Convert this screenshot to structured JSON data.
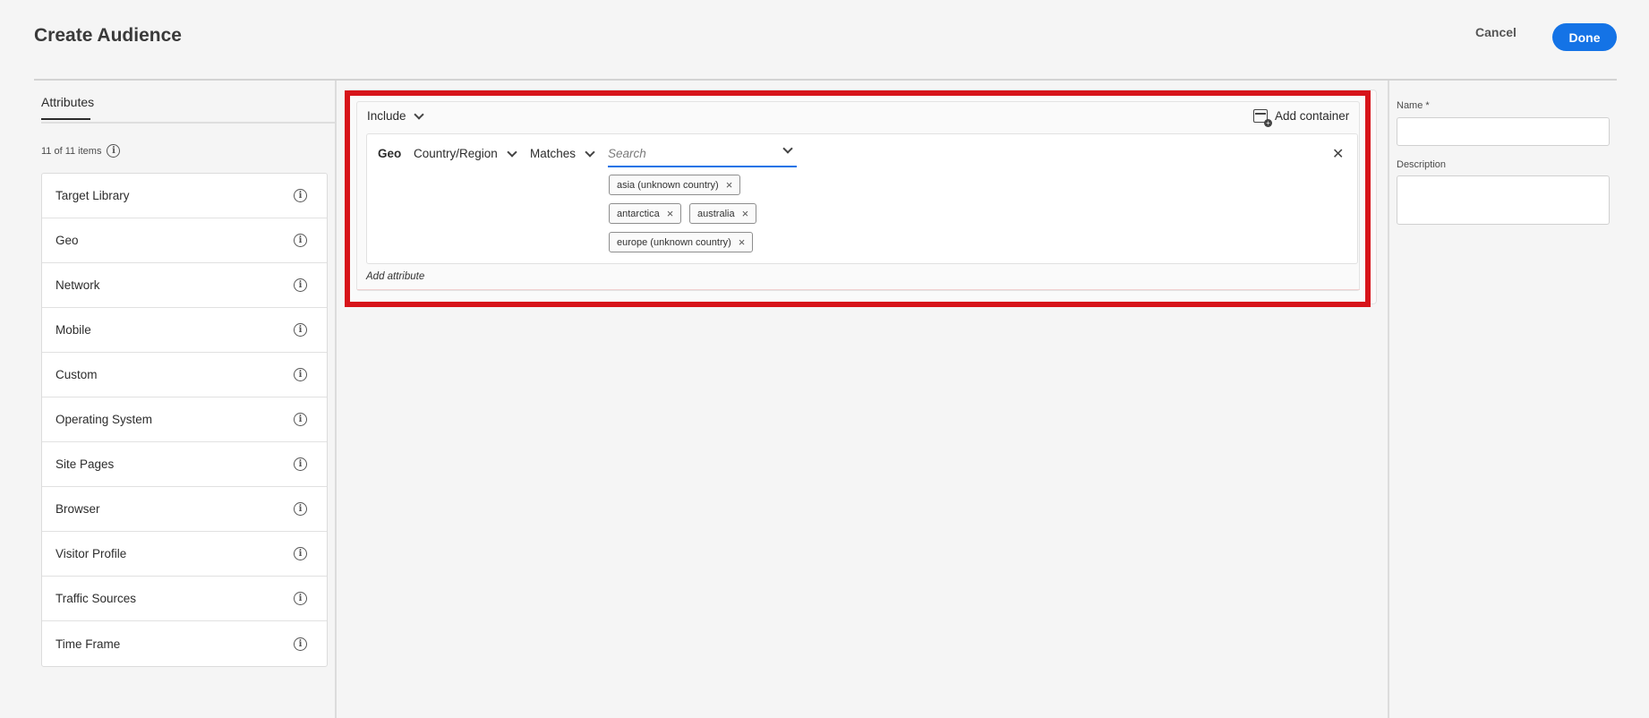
{
  "header": {
    "title": "Create Audience",
    "cancel_label": "Cancel",
    "done_label": "Done"
  },
  "sidebar": {
    "tab_label": "Attributes",
    "count_text": "11 of 11 items",
    "items": [
      {
        "label": "Target Library"
      },
      {
        "label": "Geo"
      },
      {
        "label": "Network"
      },
      {
        "label": "Mobile"
      },
      {
        "label": "Custom"
      },
      {
        "label": "Operating System"
      },
      {
        "label": "Site Pages"
      },
      {
        "label": "Browser"
      },
      {
        "label": "Visitor Profile"
      },
      {
        "label": "Traffic Sources"
      },
      {
        "label": "Time Frame"
      }
    ]
  },
  "builder": {
    "include_label": "Include",
    "add_container_label": "Add container",
    "rule": {
      "attribute": "Geo",
      "field": "Country/Region",
      "operator": "Matches",
      "search_placeholder": "Search",
      "tags": [
        {
          "label": "asia (unknown country)"
        },
        {
          "label": "antarctica"
        },
        {
          "label": "australia"
        },
        {
          "label": "europe (unknown country)"
        }
      ]
    },
    "add_attribute_label": "Add attribute"
  },
  "details": {
    "name_label": "Name *",
    "name_value": "",
    "description_label": "Description",
    "description_value": ""
  },
  "colors": {
    "accent": "#1473e6",
    "highlight": "#d7141a"
  },
  "icons": [
    "info-icon",
    "chevron-down-icon",
    "add-container-icon",
    "close-icon"
  ]
}
